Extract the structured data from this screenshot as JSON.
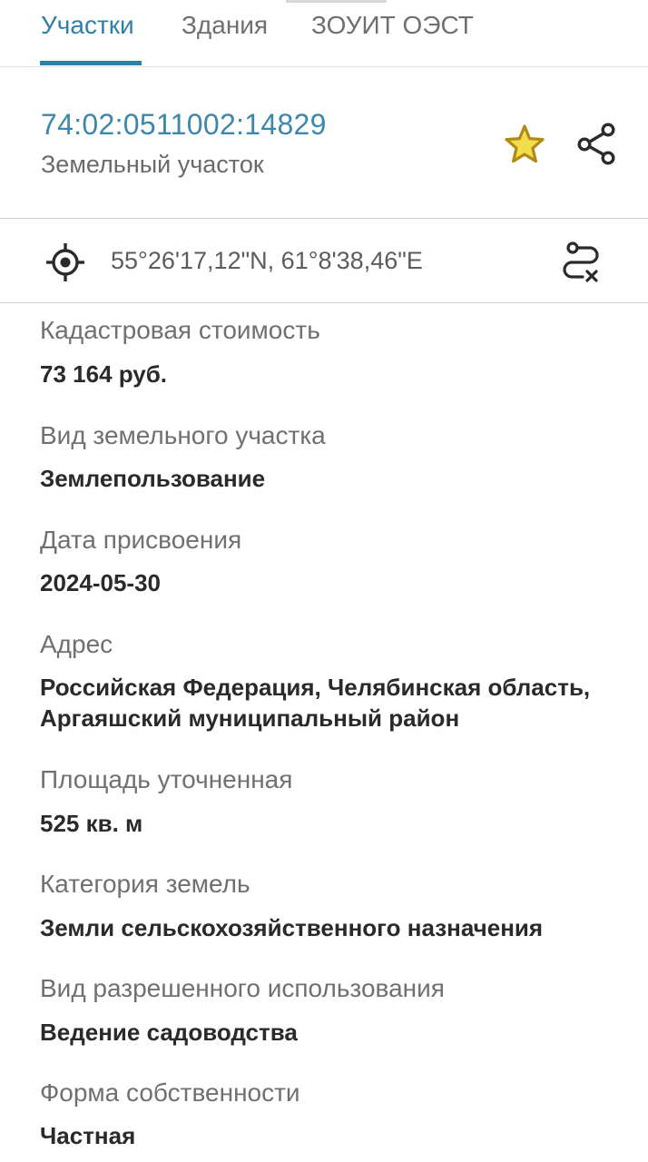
{
  "tabs": [
    {
      "label": "Участки",
      "active": true
    },
    {
      "label": "Здания",
      "active": false
    },
    {
      "label": "ЗОУИТ ОЭСТ",
      "active": false
    }
  ],
  "header": {
    "cadastral_number": "74:02:0511002:14829",
    "object_type": "Земельный участок",
    "favorite_icon": "star-icon",
    "share_icon": "share-icon"
  },
  "coordinates": {
    "text": "55°26'17,12\"N, 61°8'38,46\"E",
    "locate_icon": "crosshair-icon",
    "route_icon": "route-cancel-icon"
  },
  "properties": [
    {
      "label": "Кадастровая стоимость",
      "value": "73 164 руб."
    },
    {
      "label": "Вид земельного участка",
      "value": "Землепользование"
    },
    {
      "label": "Дата присвоения",
      "value": "2024-05-30"
    },
    {
      "label": "Адрес",
      "value": "Российская Федерация, Челябинская область, Аргаяшский муниципальный район"
    },
    {
      "label": "Площадь уточненная",
      "value": "525 кв. м"
    },
    {
      "label": "Категория земель",
      "value": "Земли сельскохозяйственного назначения"
    },
    {
      "label": "Вид разрешенного использования",
      "value": "Ведение садоводства"
    },
    {
      "label": "Форма собственности",
      "value": "Частная"
    }
  ],
  "colors": {
    "accent": "#2f7fa6",
    "link": "#3d86ad",
    "star_fill": "#f2dd4a",
    "star_stroke": "#b08a16"
  }
}
